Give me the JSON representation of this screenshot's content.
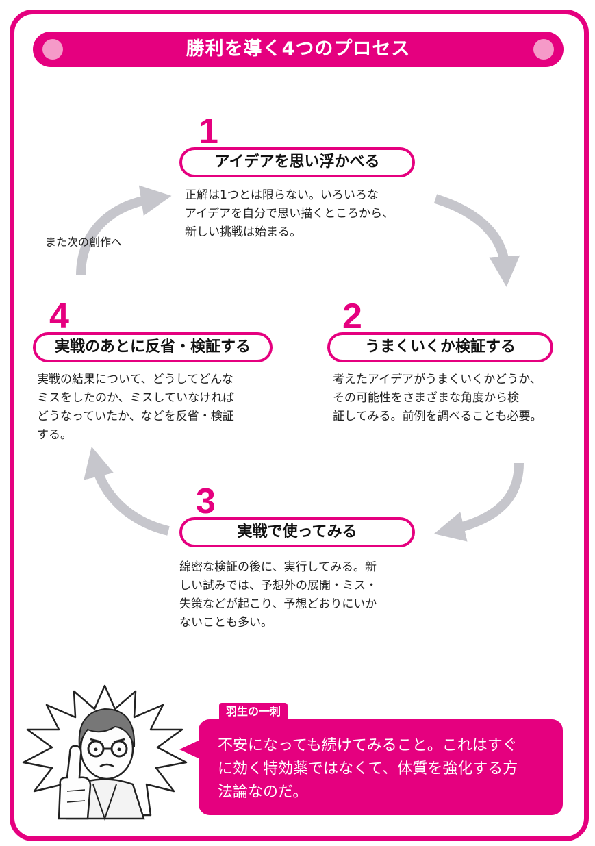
{
  "title": "勝利を導く4つのプロセス",
  "steps": [
    {
      "number": "1",
      "heading": "アイデアを思い浮かべる",
      "description": "正解は1つとは限らない。いろいろな\nアイデアを自分で思い描くところから、\n新しい挑戦は始まる。"
    },
    {
      "number": "2",
      "heading": "うまくいくか検証する",
      "description": "考えたアイデアがうまくいくかどうか、\nその可能性をさまざまな角度から検\n証してみる。前例を調べることも必要。"
    },
    {
      "number": "3",
      "heading": "実戦で使ってみる",
      "description": "綿密な検証の後に、実行してみる。新\nしい試みでは、予想外の展開・ミス・\n失策などが起こり、予想どおりにいか\nないことも多い。"
    },
    {
      "number": "4",
      "heading": "実戦のあとに反省・検証する",
      "description": "実戦の結果について、どうしてどんな\nミスをしたのか、ミスしていなければ\nどうなっていたか、などを反省・検証\nする。"
    }
  ],
  "cycle_note": "また次の創作へ",
  "quote": {
    "label": "羽生の一刺",
    "text": "不安になっても続けてみること。これはすぐ\nに効く特効薬ではなくて、体質を強化する方\n法論なのだ。"
  },
  "colors": {
    "accent": "#e5007f",
    "accent_light": "#f59ac8",
    "arrow": "#c6c6cc"
  }
}
